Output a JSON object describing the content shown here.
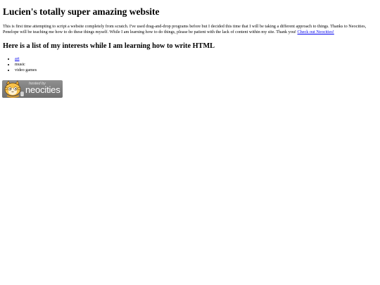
{
  "page": {
    "title": "Lucien's totally super amazing website",
    "intro_text": "This is first time attempting to script a website completely from scratch. I've used drag-and-drop programs before but I decided this time that I will be taking a different approach to things. Thanks to Neocities, Penelope will be teaching me how to do these things myself. While I am learning how to do things, please be patient with the lack of content within my site. Thank you! ",
    "intro_link": "Check out Neocities!",
    "interests_heading": "Here is a list of my interests while I am learning how to write HTML",
    "interests": [
      {
        "label": "art",
        "is_link": true
      },
      {
        "label": "music",
        "is_link": false
      },
      {
        "label": "video games",
        "is_link": false
      }
    ]
  },
  "badge": {
    "hosted_by": "hosted by",
    "brand": "neocities",
    "icon": "neocities-cat-mascot-icon"
  },
  "colors": {
    "link": "#0000ee",
    "badge_bg": "#7a7a7a",
    "text": "#000000"
  }
}
